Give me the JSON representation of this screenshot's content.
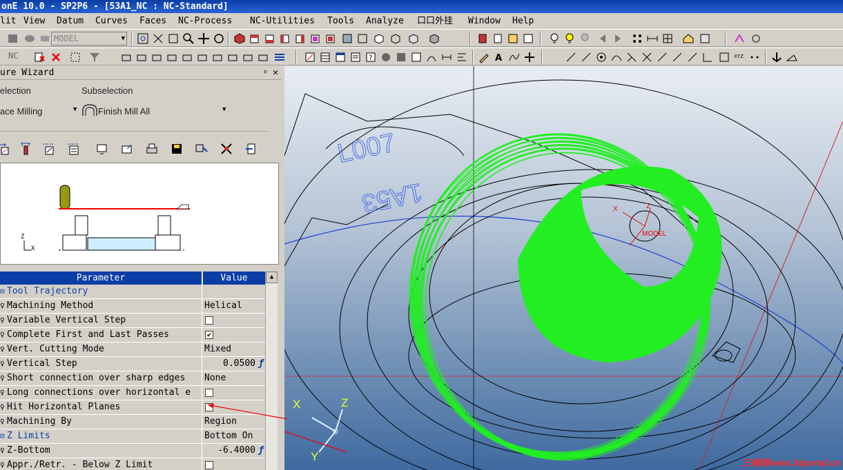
{
  "window": {
    "title": "onE 10.0 - SP2P6 - [53A1_NC : NC-Standard]"
  },
  "menu": [
    "lit",
    "View",
    "Datum",
    "Curves",
    "Faces",
    "NC-Process",
    "NC-Utilities",
    "Tools",
    "Analyze",
    "口口外挂",
    "Window",
    "Help"
  ],
  "toolbar1": {
    "mode_combo": "MODEL"
  },
  "toolbar2": {
    "nc_label": "NC"
  },
  "wizard": {
    "title": "ure Wizard",
    "pin": "ᵖ",
    "close": "✕",
    "selection_label": "election",
    "subselection_label": "Subselection",
    "selection_value": "ace Milling",
    "subselection_value": "Finish Mill All"
  },
  "preview": {
    "axis_z": "Z",
    "axis_x": "X"
  },
  "params": {
    "header_parameter": "Parameter",
    "header_value": "Value",
    "rows": [
      {
        "name": "Tool Trajectory",
        "value": "",
        "kind": "section"
      },
      {
        "name": "Machining Method",
        "value": "Helical",
        "kind": "text"
      },
      {
        "name": "Variable Vertical Step",
        "value": "",
        "kind": "checkbox",
        "checked": false
      },
      {
        "name": "Complete First and Last Passes",
        "value": "",
        "kind": "checkbox",
        "checked": true
      },
      {
        "name": "Vert. Cutting Mode",
        "value": "Mixed",
        "kind": "text"
      },
      {
        "name": "Vertical Step",
        "value": "0.0500",
        "kind": "number"
      },
      {
        "name": "Short connection over sharp edges",
        "value": "None",
        "kind": "text"
      },
      {
        "name": "Long connections over horizontal e",
        "value": "",
        "kind": "checkbox",
        "checked": false
      },
      {
        "name": "Hit Horizontal Planes",
        "value": "",
        "kind": "checkbox",
        "checked": false
      },
      {
        "name": "Machining By",
        "value": "Region",
        "kind": "text"
      },
      {
        "name": "Z Limits",
        "value": "Bottom On",
        "kind": "section"
      },
      {
        "name": "Z-Bottom",
        "value": "-6.4000",
        "kind": "number"
      },
      {
        "name": "Appr./Retr. - Below Z Limit",
        "value": "",
        "kind": "checkbox",
        "checked": false
      }
    ],
    "fx_symbol": "ƒ"
  },
  "viewport": {
    "axis_x": "X",
    "axis_y": "Y",
    "axis_z": "Z",
    "model_label": "MODEL",
    "part_text_1": "L007",
    "part_text_2": "1A53",
    "watermark": "三维网www.3dportal.cn",
    "colors": {
      "toolpath": "#22ee22",
      "wire": "#000000",
      "axis_line_blue": "#1a3fd6",
      "axis_line_red": "#cc2a2a"
    }
  }
}
